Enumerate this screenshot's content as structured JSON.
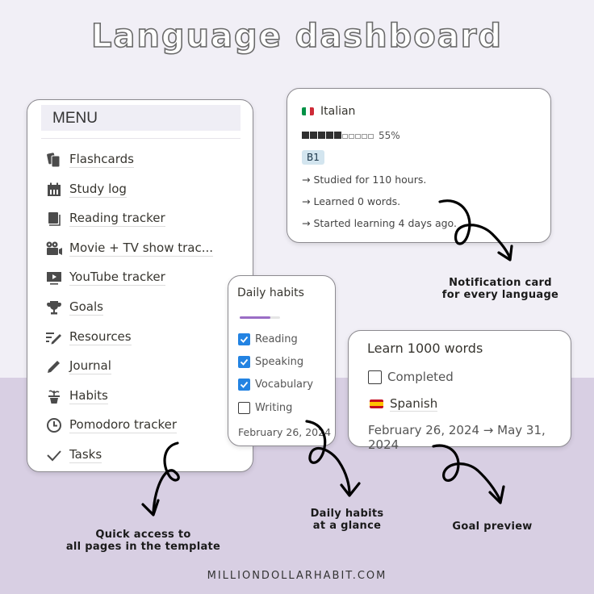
{
  "title": "Language dashboard",
  "menu": {
    "header": "MENU",
    "items": [
      {
        "label": "Flashcards",
        "icon": "flashcards-icon"
      },
      {
        "label": "Study log",
        "icon": "calendar-icon"
      },
      {
        "label": "Reading tracker",
        "icon": "book-icon"
      },
      {
        "label": "Movie + TV show trac...",
        "icon": "video-camera-icon"
      },
      {
        "label": "YouTube tracker",
        "icon": "play-icon"
      },
      {
        "label": "Goals",
        "icon": "trophy-icon"
      },
      {
        "label": "Resources",
        "icon": "list-edit-icon"
      },
      {
        "label": "Journal",
        "icon": "pencil-icon"
      },
      {
        "label": "Habits",
        "icon": "plant-icon"
      },
      {
        "label": "Pomodoro tracker",
        "icon": "clock-icon"
      },
      {
        "label": "Tasks",
        "icon": "checkmark-icon"
      }
    ]
  },
  "language_card": {
    "language": "Italian",
    "flag_colors": [
      "#009246",
      "#ffffff",
      "#ce2b37"
    ],
    "progress_percent": 55,
    "progress_label": "55%",
    "progress_filled_blocks": 5,
    "progress_total_blocks": 10,
    "level_badge": "B1",
    "lines": [
      "→ Studied for 110 hours.",
      "→ Learned 0 words.",
      "→ Started learning 4 days ago."
    ]
  },
  "habits_card": {
    "title": "Daily habits",
    "progress_fraction": 0.75,
    "accent_color": "#9a6dc5",
    "habits": [
      {
        "label": "Reading",
        "checked": true
      },
      {
        "label": "Speaking",
        "checked": true
      },
      {
        "label": "Vocabulary",
        "checked": true
      },
      {
        "label": "Writing",
        "checked": false
      }
    ],
    "date": "February 26, 2024"
  },
  "goal_card": {
    "title": "Learn 1000 words",
    "completed_label": "Completed",
    "completed": false,
    "language": "Spanish",
    "flag_colors": [
      "#c60b1e",
      "#ffc400",
      "#c60b1e"
    ],
    "date_range": "February 26, 2024 → May 31, 2024"
  },
  "captions": {
    "notification": [
      "Notification card",
      "for every language"
    ],
    "quick_access": [
      "Quick access to",
      "all pages in the template"
    ],
    "daily_habits": [
      "Daily habits",
      "at a glance"
    ],
    "goal_preview": [
      "Goal preview"
    ]
  },
  "footer": "MILLIONDOLLARHABIT.COM",
  "colors": {
    "background_top": "#f1eff6",
    "background_bottom": "#d8cfe3",
    "checkbox_blue": "#2383e2",
    "badge_bg": "#d3e5ef"
  }
}
